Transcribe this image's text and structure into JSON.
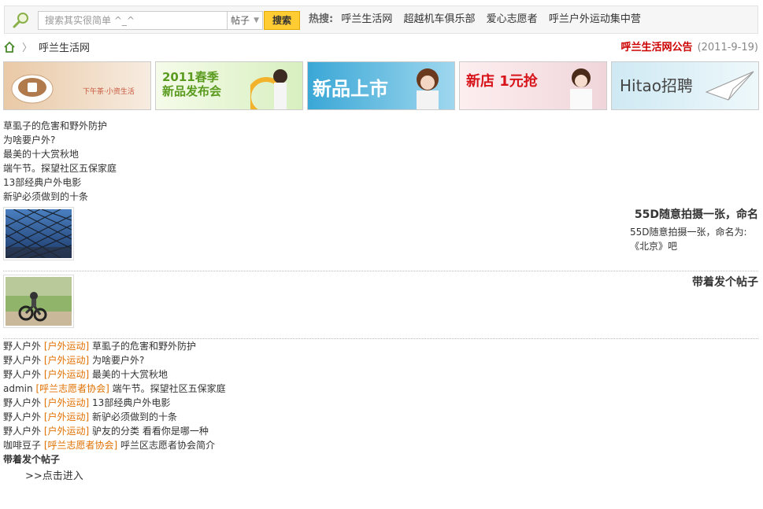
{
  "search": {
    "placeholder": "搜索其实很简单 ^_^",
    "type_selected": "帖子",
    "button_label": "搜索",
    "hot_label": "热搜:",
    "hot_links": [
      "呼兰生活网",
      "超越机车俱乐部",
      "爱心志愿者",
      "呼兰户外运动集中营"
    ]
  },
  "breadcrumb": {
    "current": "呼兰生活网"
  },
  "notice": {
    "title": "呼兰生活网公告",
    "date": "(2011-9-19)"
  },
  "banners": [
    {
      "title": "下午茶·小资生活",
      "color": "#f3d9c3",
      "accent": "#c8553d"
    },
    {
      "title": "2011春季 新品发布会",
      "color": "#eaf6d6",
      "accent": "#5a9b1f"
    },
    {
      "title": "新品上市",
      "color": "#bfe3f3",
      "accent": "#ffffff"
    },
    {
      "title": "新店 1元抢",
      "color": "#f6e0e3",
      "accent": "#d7141a"
    },
    {
      "title": "Hitao招聘",
      "color": "#d8eef5",
      "accent": "#444444"
    }
  ],
  "top_list": [
    "草虱子的危害和野外防护",
    "为啥要户外?",
    "最美的十大赏秋地",
    "端午节。探望社区五保家庭",
    "13部经典户外电影",
    "新驴必须做到的十条"
  ],
  "featured": [
    {
      "title": "55D随意拍摄一张，命名",
      "desc": "55D随意拍摄一张，命名为:《北京》吧"
    },
    {
      "title": "带着发个帖子",
      "desc": ""
    }
  ],
  "posts": [
    {
      "author": "野人户外",
      "category": "[户外运动]",
      "title": "草虱子的危害和野外防护"
    },
    {
      "author": "野人户外",
      "category": "[户外运动]",
      "title": "为啥要户外?"
    },
    {
      "author": "野人户外",
      "category": "[户外运动]",
      "title": "最美的十大赏秋地"
    },
    {
      "author": "admin",
      "category": "[呼兰志愿者协会]",
      "title": "端午节。探望社区五保家庭"
    },
    {
      "author": "野人户外",
      "category": "[户外运动]",
      "title": "13部经典户外电影"
    },
    {
      "author": "野人户外",
      "category": "[户外运动]",
      "title": "新驴必须做到的十条"
    },
    {
      "author": "野人户外",
      "category": "[户外运动]",
      "title": "驴友的分类 看看你是哪一种"
    },
    {
      "author": "咖啡豆子",
      "category": "[呼兰志愿者协会]",
      "title": "呼兰区志愿者协会简介"
    }
  ],
  "bottom": {
    "title": "带着发个帖子",
    "link": ">>点击进入"
  }
}
